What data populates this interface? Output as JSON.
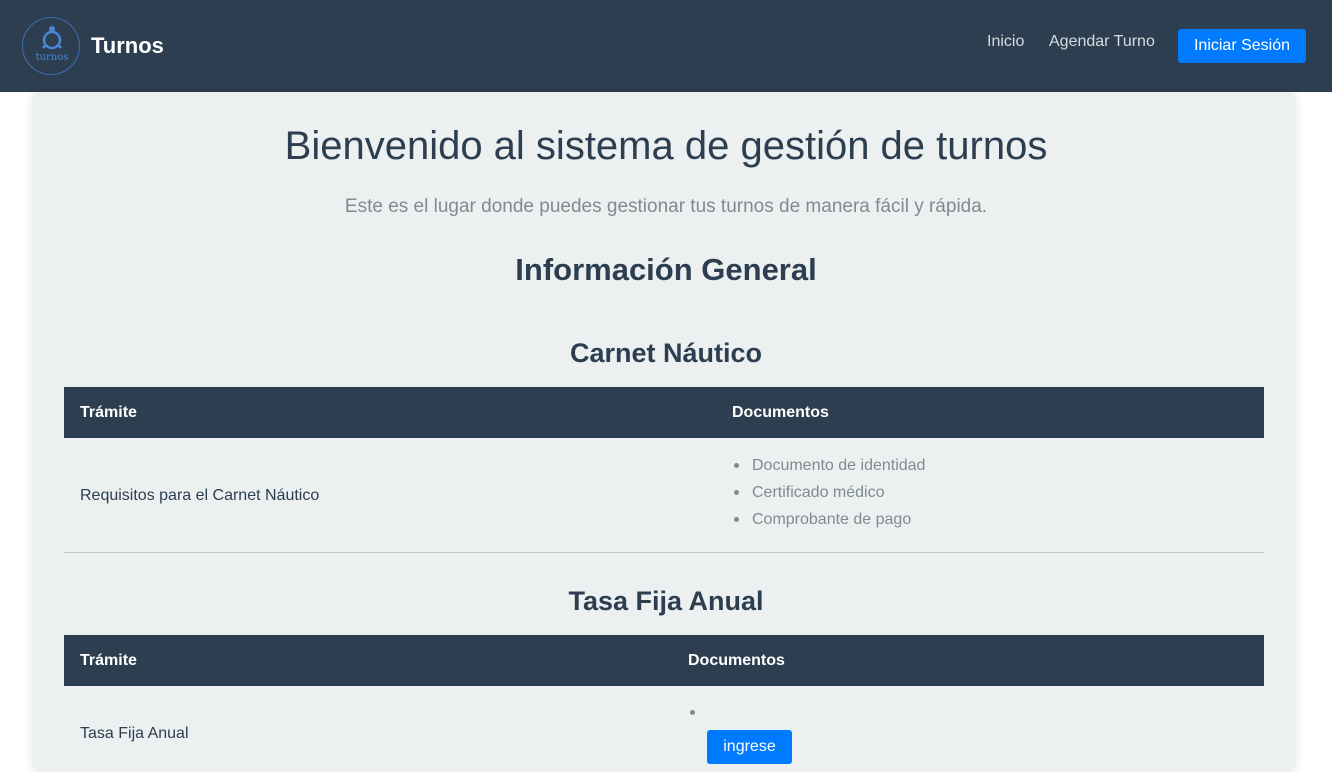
{
  "navbar": {
    "logo_text": "turnos",
    "brand": "Turnos",
    "links": [
      "Inicio",
      "Agendar Turno"
    ],
    "login_label": "Iniciar Sesión"
  },
  "main": {
    "title": "Bienvenido al sistema de gestión de turnos",
    "subtitle": "Este es el lugar donde puedes gestionar tus turnos de manera fácil y rápida.",
    "section_title": "Información General"
  },
  "carnet": {
    "title": "Carnet Náutico",
    "headers": [
      "Trámite",
      "Documentos"
    ],
    "row_label": "Requisitos para el Carnet Náutico",
    "documents": [
      "Documento de identidad",
      "Certificado médico",
      "Comprobante de pago"
    ]
  },
  "tasa": {
    "title": "Tasa Fija Anual",
    "headers": [
      "Trámite",
      "Documentos"
    ],
    "row_label": "Tasa Fija Anual",
    "button_label": "ingrese"
  },
  "colors": {
    "navbar": "#2c3e50",
    "accent": "#007bff",
    "card": "#ecf0f1",
    "muted_text": "#7f8c8d"
  }
}
